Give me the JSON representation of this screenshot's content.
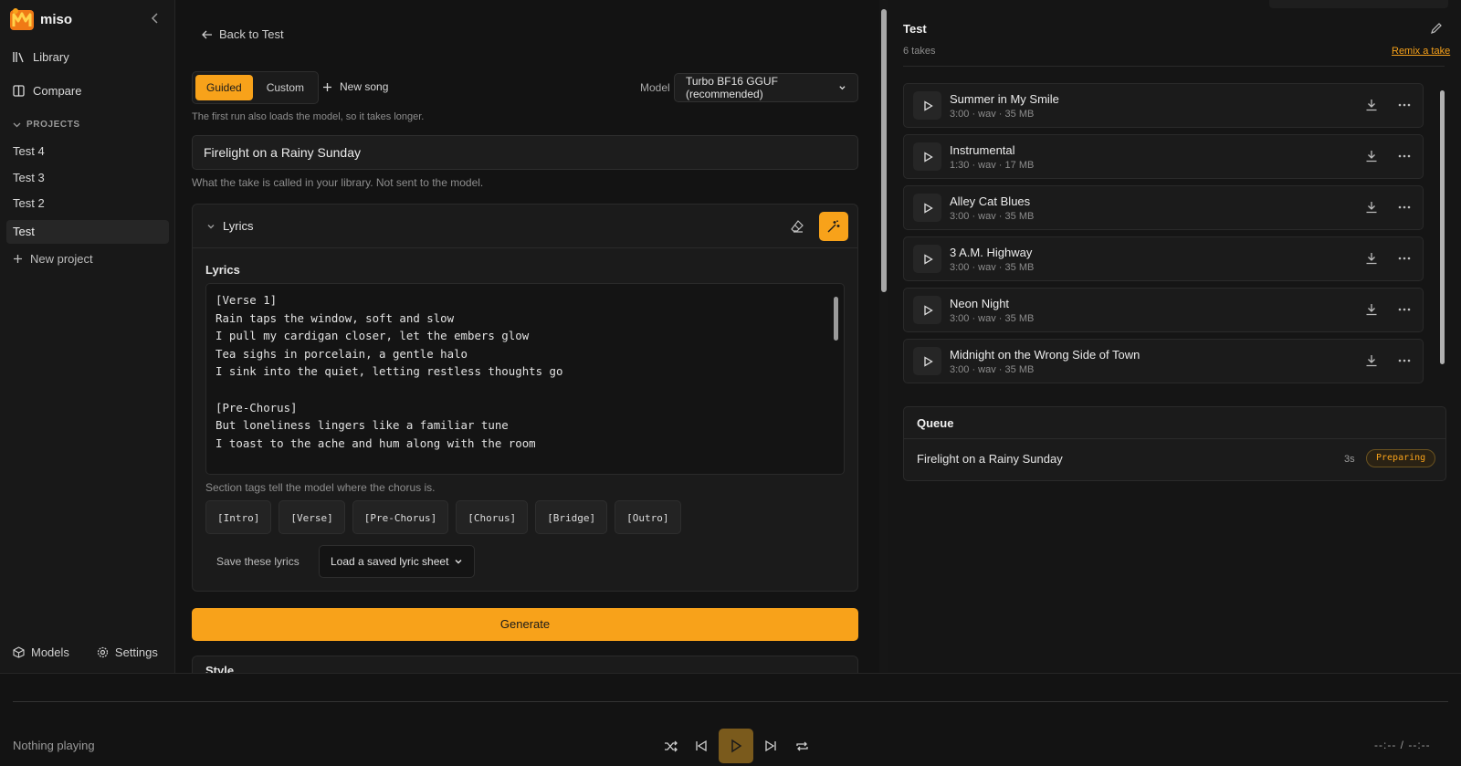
{
  "brand": {
    "name": "miso"
  },
  "sidebar": {
    "nav": [
      {
        "label": "Library",
        "icon": "library-icon"
      },
      {
        "label": "Compare",
        "icon": "compare-icon"
      }
    ],
    "projects_heading": "PROJECTS",
    "projects": [
      {
        "label": "Test 4"
      },
      {
        "label": "Test 3"
      },
      {
        "label": "Test 2"
      },
      {
        "label": "Test",
        "active": true
      }
    ],
    "new_project": "New project",
    "bottom": {
      "models": "Models",
      "settings": "Settings"
    }
  },
  "main": {
    "back": "Back to Test",
    "mode": {
      "guided": "Guided",
      "custom": "Custom",
      "selected": "Guided"
    },
    "new_song": "New song",
    "model_label": "Model",
    "model_value": "Turbo BF16 GGUF (recommended)",
    "first_run_hint": "The first run also loads the model, so it takes longer.",
    "title_value": "Firelight on a Rainy Sunday",
    "title_hint": "What the take is called in your library. Not sent to the model.",
    "lyrics_section": "Lyrics",
    "lyrics_label": "Lyrics",
    "lyrics_text": "[Verse 1]\nRain taps the window, soft and slow\nI pull my cardigan closer, let the embers glow\nTea sighs in porcelain, a gentle halo\nI sink into the quiet, letting restless thoughts go\n\n[Pre-Chorus]\nBut loneliness lingers like a familiar tune\nI toast to the ache and hum along with the room\n\n[Chorus]",
    "tags_hint": "Section tags tell the model where the chorus is.",
    "tags": [
      "[Intro]",
      "[Verse]",
      "[Pre-Chorus]",
      "[Chorus]",
      "[Bridge]",
      "[Outro]"
    ],
    "save_lyrics": "Save these lyrics",
    "load_lyrics": "Load a saved lyric sheet",
    "generate": "Generate",
    "style_label": "Style"
  },
  "right": {
    "title": "Test",
    "count": "6 takes",
    "remix": "Remix a take",
    "takes": [
      {
        "title": "Summer in My Smile",
        "meta": "3:00 · wav · 35 MB"
      },
      {
        "title": "Instrumental",
        "meta": "1:30 · wav · 17 MB"
      },
      {
        "title": "Alley Cat Blues",
        "meta": "3:00 · wav · 35 MB"
      },
      {
        "title": "3 A.M. Highway",
        "meta": "3:00 · wav · 35 MB"
      },
      {
        "title": "Neon Night",
        "meta": "3:00 · wav · 35 MB"
      },
      {
        "title": "Midnight on the Wrong Side of Town",
        "meta": "3:00 · wav · 35 MB"
      }
    ],
    "queue": {
      "title": "Queue",
      "item": "Firelight on a Rainy Sunday",
      "elapsed": "3s",
      "status": "Preparing"
    }
  },
  "player": {
    "now_playing": "Nothing playing",
    "time": "--:--  /  --:--"
  },
  "colors": {
    "accent": "#f8a21a",
    "background": "#131313",
    "panel": "#1b1b1b"
  }
}
